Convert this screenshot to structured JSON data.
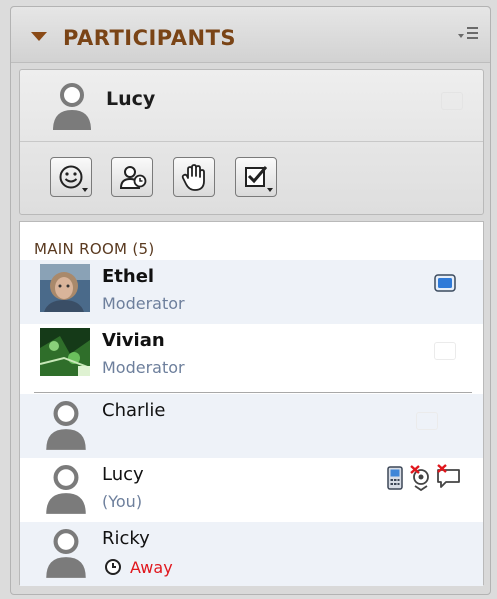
{
  "panel": {
    "title": "PARTICIPANTS",
    "icons": {
      "collapse": "triangle-down-icon",
      "menu": "panel-menu-icon"
    }
  },
  "me": {
    "name": "Lucy",
    "icon": "user-silhouette-icon"
  },
  "toolbar": {
    "buttons": [
      {
        "icon": "emoticon-icon",
        "has_dropdown": true
      },
      {
        "icon": "step-away-icon",
        "has_dropdown": false
      },
      {
        "icon": "raise-hand-icon",
        "has_dropdown": false
      },
      {
        "icon": "agree-checkbox-icon",
        "has_dropdown": true
      }
    ]
  },
  "room": {
    "title": "MAIN ROOM (5)",
    "participants": [
      {
        "name": "Ethel",
        "role": "Moderator",
        "avatar": "photo",
        "status_icon": "screen-share-icon"
      },
      {
        "name": "Vivian",
        "role": "Moderator",
        "avatar": "photo"
      },
      {
        "name": "Charlie",
        "role": "",
        "avatar": "user-silhouette-icon"
      },
      {
        "name": "Lucy",
        "subtitle": "(You)",
        "avatar": "user-silhouette-icon",
        "status_icons": [
          "phone-icon",
          "no-video-icon",
          "no-chat-icon"
        ]
      },
      {
        "name": "Ricky",
        "status": "Away",
        "status_icon": "clock-icon",
        "avatar": "user-silhouette-icon"
      }
    ]
  },
  "colors": {
    "title": "#7a4416",
    "away": "#e0171d",
    "role": "#6d7f9c",
    "alt_row": "#eef2f8"
  }
}
